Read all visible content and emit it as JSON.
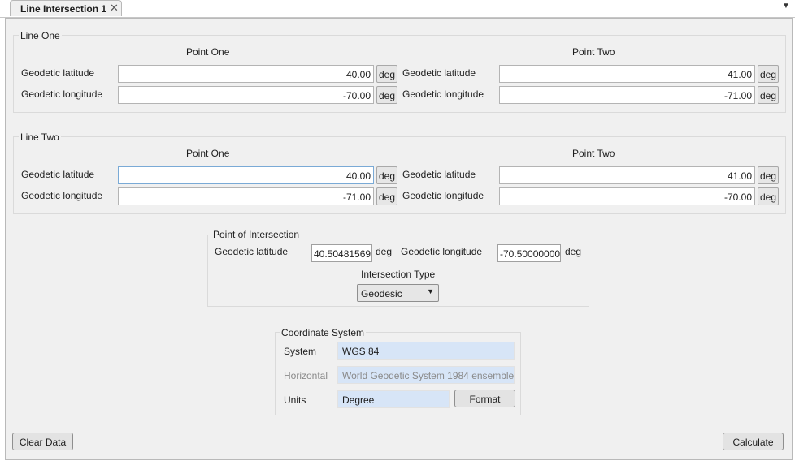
{
  "tab": {
    "title": "Line Intersection 1",
    "close_glyph": "✕",
    "menu_glyph": "▼"
  },
  "line_one": {
    "title": "Line One",
    "point_one": {
      "heading": "Point One",
      "lat_label": "Geodetic latitude",
      "lat_value": "40.00",
      "lon_label": "Geodetic longitude",
      "lon_value": "-70.00",
      "unit": "deg"
    },
    "point_two": {
      "heading": "Point Two",
      "lat_label": "Geodetic latitude",
      "lat_value": "41.00",
      "lon_label": "Geodetic longitude",
      "lon_value": "-71.00",
      "unit": "deg"
    }
  },
  "line_two": {
    "title": "Line Two",
    "point_one": {
      "heading": "Point One",
      "lat_label": "Geodetic latitude",
      "lat_value": "40.00",
      "lon_label": "Geodetic longitude",
      "lon_value": "-71.00",
      "unit": "deg"
    },
    "point_two": {
      "heading": "Point Two",
      "lat_label": "Geodetic latitude",
      "lat_value": "41.00",
      "lon_label": "Geodetic longitude",
      "lon_value": "-70.00",
      "unit": "deg"
    }
  },
  "intersection": {
    "title": "Point of Intersection",
    "lat_label": "Geodetic latitude",
    "lat_value": "40.50481569",
    "lat_unit": "deg",
    "lon_label": "Geodetic longitude",
    "lon_value": "-70.50000000",
    "lon_unit": "deg",
    "type_label": "Intersection Type",
    "type_value": "Geodesic",
    "arrow_glyph": "▼"
  },
  "coordinate_system": {
    "title": "Coordinate System",
    "system_label": "System",
    "system_value": "WGS 84",
    "horizontal_label": "Horizontal",
    "horizontal_value": "World Geodetic System 1984 ensemble",
    "units_label": "Units",
    "units_value": "Degree",
    "format_label": "Format"
  },
  "buttons": {
    "clear_data": "Clear Data",
    "calculate": "Calculate"
  },
  "colors": {
    "panel": "#f0f0f0",
    "readonly_field": "#d7e5f7",
    "border": "#b9b9b9"
  }
}
